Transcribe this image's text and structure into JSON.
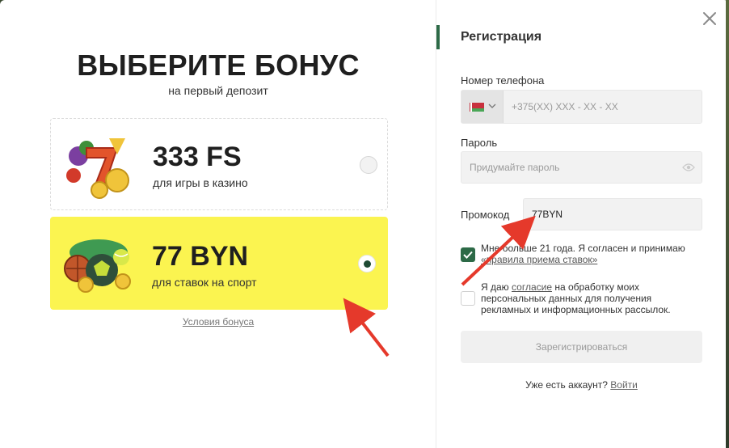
{
  "bonus": {
    "title": "ВЫБЕРИТЕ БОНУС",
    "subtitle": "на первый депозит",
    "options": [
      {
        "amount": "333 FS",
        "description": "для игры в казино",
        "selected": false,
        "image": "casino-slot-icon"
      },
      {
        "amount": "77 BYN",
        "description": "для ставок на спорт",
        "selected": true,
        "image": "sport-balls-icon"
      }
    ],
    "terms_link": "Условия бонуса"
  },
  "registration": {
    "title": "Регистрация",
    "phone": {
      "label": "Номер телефона",
      "placeholder": "+375(XX) XXX - XX - XX",
      "country_icon": "belarus-flag-icon"
    },
    "password": {
      "label": "Пароль",
      "placeholder": "Придумайте пароль"
    },
    "promo": {
      "label": "Промокод",
      "value": "77BYN"
    },
    "age_consent": {
      "checked": true,
      "text_before": "Мне больше 21 года. Я согласен и принимаю ",
      "link": "«правила приема ставок»"
    },
    "data_consent": {
      "checked": false,
      "text_before": "Я даю ",
      "link": "согласие",
      "text_after": " на обработку моих персональных данных для получения рекламных и информационных рассылок."
    },
    "submit_label": "Зарегистрироваться",
    "have_account": "Уже есть аккаунт?",
    "login_link": "Войти"
  },
  "colors": {
    "accent_green": "#2d6a47",
    "sport_card_bg": "#fbf450",
    "annotation_arrow": "#e5392b"
  }
}
